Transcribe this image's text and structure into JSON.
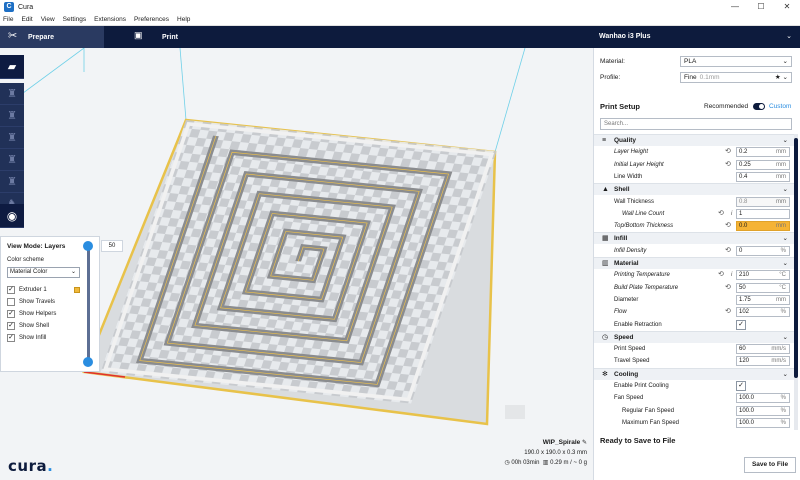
{
  "window": {
    "title": "Cura",
    "app_icon": "C"
  },
  "menu": [
    "File",
    "Edit",
    "View",
    "Settings",
    "Extensions",
    "Preferences",
    "Help"
  ],
  "stages": {
    "prepare": "Prepare",
    "print": "Print"
  },
  "printer": {
    "name": "Wanhao i3 Plus"
  },
  "material": {
    "label": "Material:",
    "value": "PLA"
  },
  "profile": {
    "label": "Profile:",
    "value": "Fine",
    "detail": "0.1mm"
  },
  "print_setup": {
    "title": "Print Setup",
    "recommended": "Recommended",
    "custom": "Custom",
    "search_placeholder": "Search..."
  },
  "settings": [
    {
      "type": "category",
      "icon": "quality-icon",
      "glyph": "≡",
      "label": "Quality"
    },
    {
      "type": "setting",
      "label": "Layer Height",
      "italic": true,
      "reset": true,
      "value": "0.2",
      "unit": "mm"
    },
    {
      "type": "setting",
      "label": "Initial Layer Height",
      "italic": true,
      "reset": true,
      "value": "0.25",
      "unit": "mm"
    },
    {
      "type": "setting",
      "label": "Line Width",
      "value": "0.4",
      "unit": "mm"
    },
    {
      "type": "category",
      "icon": "shell-icon",
      "glyph": "▲",
      "label": "Shell"
    },
    {
      "type": "setting",
      "label": "Wall Thickness",
      "value": "0.8",
      "unit": "mm",
      "disabled": true
    },
    {
      "type": "setting",
      "label": "Wall Line Count",
      "italic": true,
      "sub": true,
      "reset": true,
      "info": true,
      "value": "1",
      "unit": ""
    },
    {
      "type": "setting",
      "label": "Top/Bottom Thickness",
      "italic": true,
      "reset": true,
      "value": "0.0",
      "unit": "mm",
      "warn": true
    },
    {
      "type": "category",
      "icon": "infill-icon",
      "glyph": "▦",
      "label": "Infill"
    },
    {
      "type": "setting",
      "label": "Infill Density",
      "italic": true,
      "reset": true,
      "value": "0",
      "unit": "%"
    },
    {
      "type": "category",
      "icon": "material-icon",
      "glyph": "▥",
      "label": "Material"
    },
    {
      "type": "setting",
      "label": "Printing Temperature",
      "italic": true,
      "reset": true,
      "info": true,
      "value": "210",
      "unit": "°C"
    },
    {
      "type": "setting",
      "label": "Build Plate Temperature",
      "italic": true,
      "reset": true,
      "value": "50",
      "unit": "°C"
    },
    {
      "type": "setting",
      "label": "Diameter",
      "value": "1.75",
      "unit": "mm"
    },
    {
      "type": "setting",
      "label": "Flow",
      "italic": true,
      "reset": true,
      "value": "102",
      "unit": "%"
    },
    {
      "type": "setting",
      "label": "Enable Retraction",
      "checkbox": true
    },
    {
      "type": "category",
      "icon": "speed-icon",
      "glyph": "◷",
      "label": "Speed"
    },
    {
      "type": "setting",
      "label": "Print Speed",
      "value": "60",
      "unit": "mm/s"
    },
    {
      "type": "setting",
      "label": "Travel Speed",
      "value": "120",
      "unit": "mm/s"
    },
    {
      "type": "category",
      "icon": "cooling-icon",
      "glyph": "✻",
      "label": "Cooling"
    },
    {
      "type": "setting",
      "label": "Enable Print Cooling",
      "checkbox": true
    },
    {
      "type": "setting",
      "label": "Fan Speed",
      "value": "100.0",
      "unit": "%"
    },
    {
      "type": "setting",
      "label": "Regular Fan Speed",
      "sub": true,
      "value": "100.0",
      "unit": "%"
    },
    {
      "type": "setting",
      "label": "Maximum Fan Speed",
      "sub": true,
      "value": "100.0",
      "unit": "%"
    }
  ],
  "ready": {
    "title": "Ready to Save to File",
    "save_button": "Save to File"
  },
  "object": {
    "name": "WIP_Spirale",
    "dimensions": "190.0 x 190.0 x 0.3 mm",
    "time": "00h 03min",
    "material_usage": "0.29 m / ~ 0 g"
  },
  "view_mode": {
    "title": "View Mode: Layers",
    "color_scheme_label": "Color scheme",
    "color_scheme": "Material Color",
    "checks": [
      {
        "label": "Extruder 1",
        "checked": true,
        "swatch": true
      },
      {
        "label": "Show Travels",
        "checked": false
      },
      {
        "label": "Show Helpers",
        "checked": true
      },
      {
        "label": "Show Shell",
        "checked": true
      },
      {
        "label": "Show Infill",
        "checked": true
      }
    ],
    "layer_value": "50"
  },
  "colors": {
    "accent": "#2a8de0",
    "header": "#0d1b3d",
    "warning": "#f5b335",
    "extruder": "#f0b93b"
  },
  "logo": "cura"
}
